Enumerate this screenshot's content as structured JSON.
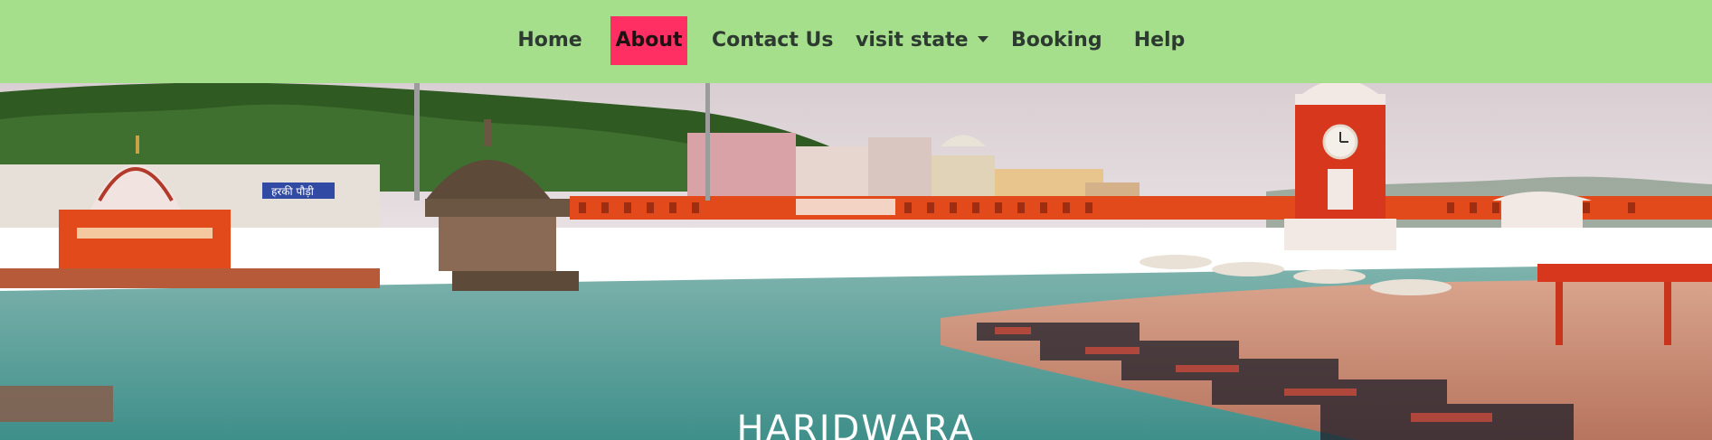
{
  "nav": {
    "items": [
      {
        "label": "Home"
      },
      {
        "label": "About",
        "active": true
      },
      {
        "label": "Contact Us"
      },
      {
        "label": "visit state",
        "dropdown": true
      },
      {
        "label": "Booking"
      },
      {
        "label": "Help"
      }
    ]
  },
  "hero": {
    "title": "HARIDWARA",
    "sign_text": "हरकी पौड़ी"
  },
  "colors": {
    "navbar_bg": "#a6df8b",
    "active_bg": "#ff2f64",
    "nav_text": "#2d3a31"
  },
  "icons": {
    "dropdown": "caret-down-icon"
  }
}
